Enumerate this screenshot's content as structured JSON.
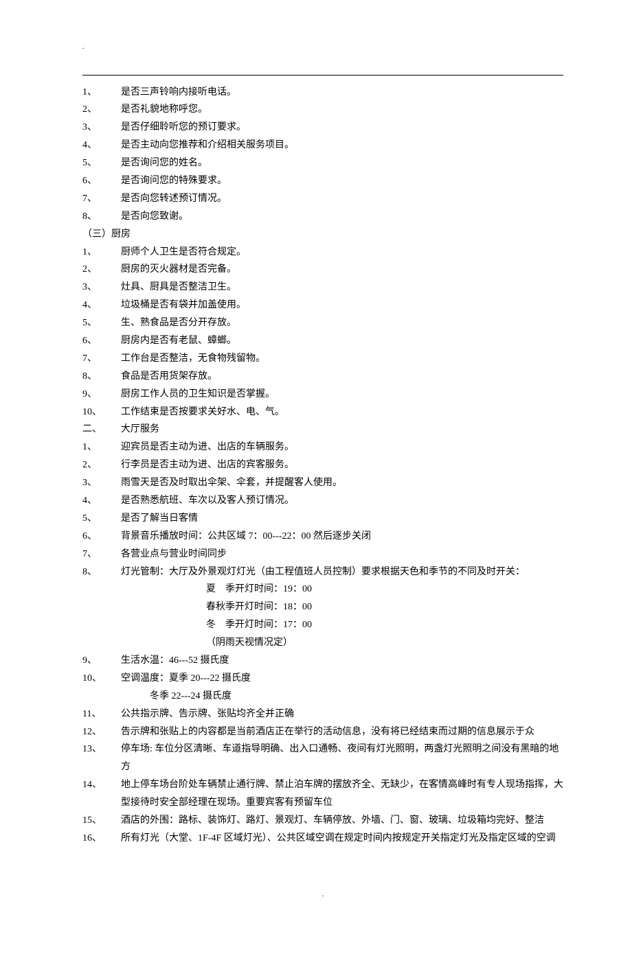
{
  "topDot": ".",
  "bottomDot": ".",
  "sectionA": [
    {
      "n": "1、",
      "t": "是否三声铃响内接听电话。"
    },
    {
      "n": "2、",
      "t": "是否礼貌地称呼您。"
    },
    {
      "n": "3、",
      "t": "是否仔细聆听您的预订要求。"
    },
    {
      "n": "4、",
      "t": "是否主动向您推荐和介绍相关服务项目。"
    },
    {
      "n": "5、",
      "t": "是否询问您的姓名。"
    },
    {
      "n": "6、",
      "t": "是否询问您的特殊要求。"
    },
    {
      "n": "7、",
      "t": "是否向您转述预订情况。"
    },
    {
      "n": "8、",
      "t": "是否向您致谢。"
    }
  ],
  "kitchenHeader": "（三）厨房",
  "kitchen": [
    {
      "n": "1、",
      "t": "厨师个人卫生是否符合规定。"
    },
    {
      "n": "2、",
      "t": "厨房的灭火器材是否完备。"
    },
    {
      "n": "3、",
      "t": "灶具、厨具是否整洁卫生。"
    },
    {
      "n": "4、",
      "t": "垃圾桶是否有袋并加盖使用。"
    },
    {
      "n": "5、",
      "t": "生、熟食品是否分开存放。"
    },
    {
      "n": "6、",
      "t": "厨房内是否有老鼠、蟑螂。"
    },
    {
      "n": "7、",
      "t": "工作台是否整洁，无食物残留物。"
    },
    {
      "n": "8、",
      "t": "食品是否用货架存放。"
    },
    {
      "n": "9、",
      "t": "厨房工作人员的卫生知识是否掌握。"
    },
    {
      "n": "10、",
      "t": "工作结束是否按要求关好水、电、气。"
    }
  ],
  "hallHeader": {
    "n": "二、",
    "t": "大厅服务"
  },
  "hall": [
    {
      "n": "1、",
      "t": "迎宾员是否主动为进、出店的车辆服务。"
    },
    {
      "n": "2、",
      "t": "行李员是否主动为进、出店的宾客服务。"
    },
    {
      "n": "3、",
      "t": "雨雪天是否及时取出伞架、伞套，并提醒客人使用。"
    },
    {
      "n": "4、",
      "t": "是否熟悉航班、车次以及客人预订情况。"
    },
    {
      "n": "5、",
      "t": "是否了解当日客情"
    },
    {
      "n": "6、",
      "t": "背景音乐播放时间：公共区域 7：00---22：00 然后逐步关闭"
    },
    {
      "n": "7、",
      "t": "各营业点与营业时间同步"
    },
    {
      "n": "8、",
      "t": "灯光管制：大厅及外景观灯灯光（由工程值班人员控制）要求根据天色和季节的不同及时开关："
    }
  ],
  "lightSchedule": [
    "夏　季开灯时间：19：00",
    "春秋季开灯时间：18：00",
    "冬　季开灯时间：17：00",
    "（阴雨天视情况定）"
  ],
  "hall2": [
    {
      "n": "9、",
      "t": "生活水温：46---52 摄氏度"
    },
    {
      "n": "10、",
      "t": "空调温度：夏季 20---22 摄氏度"
    }
  ],
  "acWinter": "冬季 22---24 摄氏度",
  "hall3": [
    {
      "n": "11、",
      "t": "公共指示牌、告示牌、张贴均齐全并正确"
    },
    {
      "n": "12、",
      "t": "告示牌和张贴上的内容都是当前酒店正在举行的活动信息，没有将已经结束而过期的信息展示于众"
    },
    {
      "n": "13、",
      "t": "停车场: 车位分区清晰、车道指导明确、出入口通畅、夜间有灯光照明，两盏灯光照明之间没有黑暗的地方"
    },
    {
      "n": "14、",
      "t": "地上停车场台阶处车辆禁止通行牌、禁止泊车牌的摆放齐全、无缺少，在客情高峰时有专人现场指挥，大型接待时安全部经理在现场。重要宾客有预留车位"
    },
    {
      "n": "15、",
      "t": "酒店的外围：路标、装饰灯、路灯、景观灯、车辆停放、外墙、门、窗、玻璃、垃圾箱均完好、整洁"
    },
    {
      "n": "16、",
      "t": "所有灯光（大堂、1F-4F 区域灯光）、公共区域空调在规定时间内按规定开关指定灯光及指定区域的空调"
    }
  ]
}
